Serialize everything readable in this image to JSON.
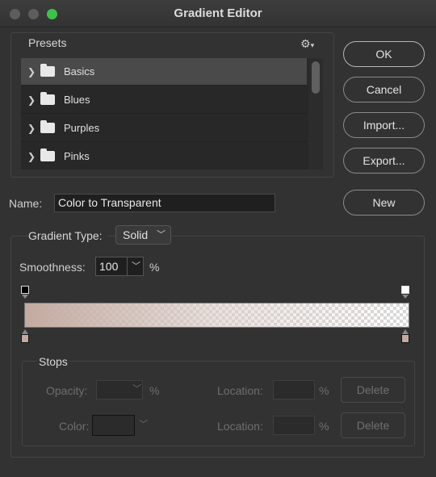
{
  "window": {
    "title": "Gradient Editor"
  },
  "presets": {
    "label": "Presets",
    "items": [
      {
        "label": "Basics",
        "selected": true
      },
      {
        "label": "Blues",
        "selected": false
      },
      {
        "label": "Purples",
        "selected": false
      },
      {
        "label": "Pinks",
        "selected": false
      }
    ]
  },
  "buttons": {
    "ok": "OK",
    "cancel": "Cancel",
    "import": "Import...",
    "export": "Export...",
    "new": "New"
  },
  "name": {
    "label": "Name:",
    "value": "Color to Transparent"
  },
  "gradient": {
    "type_label": "Gradient Type:",
    "type_value": "Solid",
    "smoothness_label": "Smoothness:",
    "smoothness_value": "100",
    "percent": "%",
    "start_color": "#c3aaa0",
    "end_color": "#e6dcd7"
  },
  "stops": {
    "label": "Stops",
    "opacity_label": "Opacity:",
    "opacity_percent": "%",
    "location_label": "Location:",
    "location_percent": "%",
    "color_label": "Color:",
    "delete_label": "Delete"
  },
  "colors": {
    "accent_green": "#3fc24c",
    "dialog_bg": "#323232"
  }
}
